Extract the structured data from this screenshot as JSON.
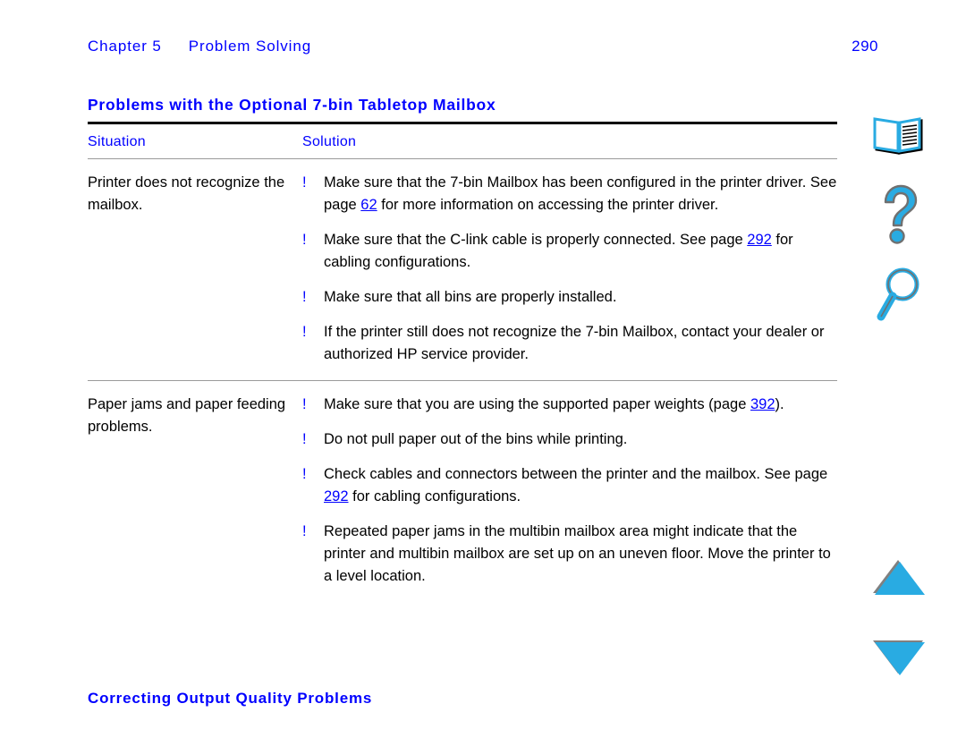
{
  "header": {
    "chapter_label": "Chapter 5",
    "chapter_title": "Problem Solving",
    "page_number": "290"
  },
  "section": {
    "heading": "Problems with the Optional 7-bin Tabletop Mailbox"
  },
  "table": {
    "columns": [
      "Situation",
      "Solution"
    ],
    "rows": [
      {
        "situation": "Printer does not recognize the mailbox.",
        "solutions": [
          {
            "bullet": "!",
            "parts": [
              {
                "text": "Make sure that the 7-bin Mailbox has been configured in the printer driver. See page "
              },
              {
                "text": "62",
                "link": true
              },
              {
                "text": " for more information on accessing the printer driver."
              }
            ]
          },
          {
            "bullet": "!",
            "parts": [
              {
                "text": "Make sure that the C-link cable is properly connected. See page "
              },
              {
                "text": "292",
                "link": true
              },
              {
                "text": " for cabling configurations."
              }
            ]
          },
          {
            "bullet": "!",
            "parts": [
              {
                "text": "Make sure that all bins are properly installed."
              }
            ]
          },
          {
            "bullet": "!",
            "parts": [
              {
                "text": "If the printer still does not recognize the 7-bin Mailbox, contact your dealer or authorized HP service provider."
              }
            ]
          }
        ]
      },
      {
        "situation": "Paper jams and paper feeding problems.",
        "solutions": [
          {
            "bullet": "!",
            "parts": [
              {
                "text": "Make sure that you are using the supported paper weights (page "
              },
              {
                "text": "392",
                "link": true
              },
              {
                "text": ")."
              }
            ]
          },
          {
            "bullet": "!",
            "parts": [
              {
                "text": "Do not pull paper out of the bins while printing."
              }
            ]
          },
          {
            "bullet": "!",
            "parts": [
              {
                "text": "Check cables and connectors between the printer and the mailbox. See page "
              },
              {
                "text": "292",
                "link": true
              },
              {
                "text": " for cabling configurations."
              }
            ]
          },
          {
            "bullet": "!",
            "parts": [
              {
                "text": "Repeated paper jams in the multibin mailbox area might indicate that the printer and multibin mailbox are set up on an uneven floor. Move the printer to a level location."
              }
            ]
          }
        ]
      }
    ]
  },
  "footer": {
    "link": "Correcting Output Quality Problems"
  },
  "nav_icons": [
    {
      "name": "book-icon",
      "title": "Contents"
    },
    {
      "name": "question-mark-icon",
      "title": "Help"
    },
    {
      "name": "magnifier-icon",
      "title": "Find"
    },
    {
      "name": "triangle-up-icon",
      "title": "Previous page"
    },
    {
      "name": "triangle-down-icon",
      "title": "Next page"
    }
  ],
  "colors": {
    "link_blue": "#0000FF",
    "icon_cyan": "#29ABE2",
    "icon_shadow": "#808080",
    "rule_black": "#000000",
    "rule_gray": "#9A9A9A"
  }
}
